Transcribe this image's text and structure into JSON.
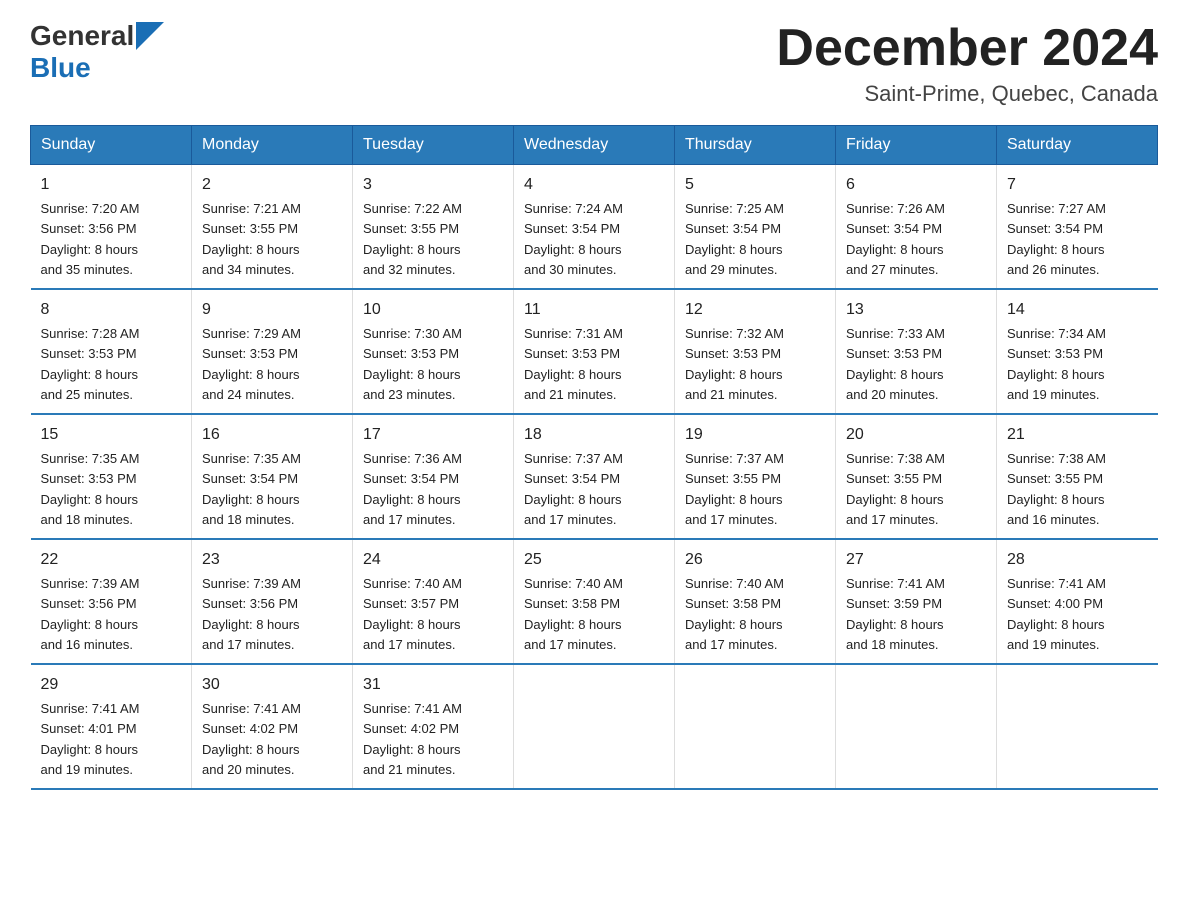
{
  "logo": {
    "general": "General",
    "blue": "Blue"
  },
  "header": {
    "month": "December 2024",
    "location": "Saint-Prime, Quebec, Canada"
  },
  "weekdays": [
    "Sunday",
    "Monday",
    "Tuesday",
    "Wednesday",
    "Thursday",
    "Friday",
    "Saturday"
  ],
  "weeks": [
    [
      {
        "day": "1",
        "sunrise": "7:20 AM",
        "sunset": "3:56 PM",
        "daylight": "8 hours and 35 minutes."
      },
      {
        "day": "2",
        "sunrise": "7:21 AM",
        "sunset": "3:55 PM",
        "daylight": "8 hours and 34 minutes."
      },
      {
        "day": "3",
        "sunrise": "7:22 AM",
        "sunset": "3:55 PM",
        "daylight": "8 hours and 32 minutes."
      },
      {
        "day": "4",
        "sunrise": "7:24 AM",
        "sunset": "3:54 PM",
        "daylight": "8 hours and 30 minutes."
      },
      {
        "day": "5",
        "sunrise": "7:25 AM",
        "sunset": "3:54 PM",
        "daylight": "8 hours and 29 minutes."
      },
      {
        "day": "6",
        "sunrise": "7:26 AM",
        "sunset": "3:54 PM",
        "daylight": "8 hours and 27 minutes."
      },
      {
        "day": "7",
        "sunrise": "7:27 AM",
        "sunset": "3:54 PM",
        "daylight": "8 hours and 26 minutes."
      }
    ],
    [
      {
        "day": "8",
        "sunrise": "7:28 AM",
        "sunset": "3:53 PM",
        "daylight": "8 hours and 25 minutes."
      },
      {
        "day": "9",
        "sunrise": "7:29 AM",
        "sunset": "3:53 PM",
        "daylight": "8 hours and 24 minutes."
      },
      {
        "day": "10",
        "sunrise": "7:30 AM",
        "sunset": "3:53 PM",
        "daylight": "8 hours and 23 minutes."
      },
      {
        "day": "11",
        "sunrise": "7:31 AM",
        "sunset": "3:53 PM",
        "daylight": "8 hours and 21 minutes."
      },
      {
        "day": "12",
        "sunrise": "7:32 AM",
        "sunset": "3:53 PM",
        "daylight": "8 hours and 21 minutes."
      },
      {
        "day": "13",
        "sunrise": "7:33 AM",
        "sunset": "3:53 PM",
        "daylight": "8 hours and 20 minutes."
      },
      {
        "day": "14",
        "sunrise": "7:34 AM",
        "sunset": "3:53 PM",
        "daylight": "8 hours and 19 minutes."
      }
    ],
    [
      {
        "day": "15",
        "sunrise": "7:35 AM",
        "sunset": "3:53 PM",
        "daylight": "8 hours and 18 minutes."
      },
      {
        "day": "16",
        "sunrise": "7:35 AM",
        "sunset": "3:54 PM",
        "daylight": "8 hours and 18 minutes."
      },
      {
        "day": "17",
        "sunrise": "7:36 AM",
        "sunset": "3:54 PM",
        "daylight": "8 hours and 17 minutes."
      },
      {
        "day": "18",
        "sunrise": "7:37 AM",
        "sunset": "3:54 PM",
        "daylight": "8 hours and 17 minutes."
      },
      {
        "day": "19",
        "sunrise": "7:37 AM",
        "sunset": "3:55 PM",
        "daylight": "8 hours and 17 minutes."
      },
      {
        "day": "20",
        "sunrise": "7:38 AM",
        "sunset": "3:55 PM",
        "daylight": "8 hours and 17 minutes."
      },
      {
        "day": "21",
        "sunrise": "7:38 AM",
        "sunset": "3:55 PM",
        "daylight": "8 hours and 16 minutes."
      }
    ],
    [
      {
        "day": "22",
        "sunrise": "7:39 AM",
        "sunset": "3:56 PM",
        "daylight": "8 hours and 16 minutes."
      },
      {
        "day": "23",
        "sunrise": "7:39 AM",
        "sunset": "3:56 PM",
        "daylight": "8 hours and 17 minutes."
      },
      {
        "day": "24",
        "sunrise": "7:40 AM",
        "sunset": "3:57 PM",
        "daylight": "8 hours and 17 minutes."
      },
      {
        "day": "25",
        "sunrise": "7:40 AM",
        "sunset": "3:58 PM",
        "daylight": "8 hours and 17 minutes."
      },
      {
        "day": "26",
        "sunrise": "7:40 AM",
        "sunset": "3:58 PM",
        "daylight": "8 hours and 17 minutes."
      },
      {
        "day": "27",
        "sunrise": "7:41 AM",
        "sunset": "3:59 PM",
        "daylight": "8 hours and 18 minutes."
      },
      {
        "day": "28",
        "sunrise": "7:41 AM",
        "sunset": "4:00 PM",
        "daylight": "8 hours and 19 minutes."
      }
    ],
    [
      {
        "day": "29",
        "sunrise": "7:41 AM",
        "sunset": "4:01 PM",
        "daylight": "8 hours and 19 minutes."
      },
      {
        "day": "30",
        "sunrise": "7:41 AM",
        "sunset": "4:02 PM",
        "daylight": "8 hours and 20 minutes."
      },
      {
        "day": "31",
        "sunrise": "7:41 AM",
        "sunset": "4:02 PM",
        "daylight": "8 hours and 21 minutes."
      },
      null,
      null,
      null,
      null
    ]
  ],
  "labels": {
    "sunrise": "Sunrise:",
    "sunset": "Sunset:",
    "daylight": "Daylight:"
  }
}
